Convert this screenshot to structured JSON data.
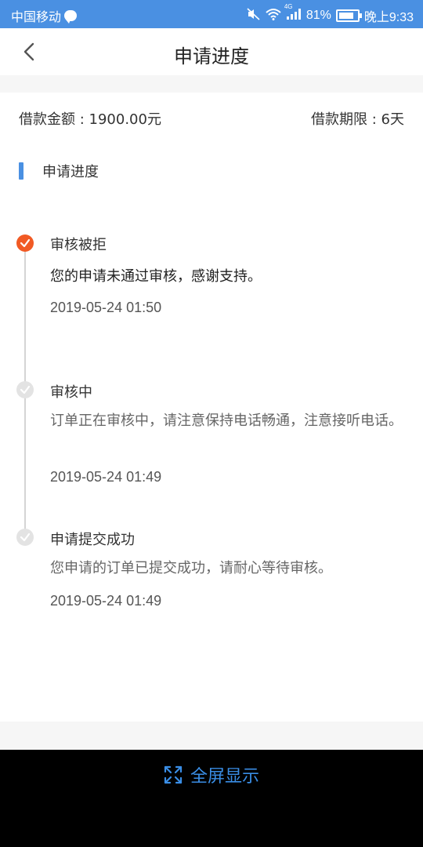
{
  "status_bar": {
    "carrier": "中国移动",
    "network": "4G",
    "battery": "81%",
    "time": "晚上9:33",
    "icons": [
      "chat-bubble-icon",
      "mute-icon",
      "wifi-icon",
      "signal-icon",
      "battery-icon"
    ]
  },
  "header": {
    "title": "申请进度",
    "back_icon": "chevron-left-icon"
  },
  "loan": {
    "amount_text": "借款金额 : 1900.00元",
    "term_text": "借款期限 : 6天"
  },
  "section": {
    "title": "申请进度",
    "accent_color": "#4a90e2"
  },
  "timeline": [
    {
      "title": "审核被拒",
      "description": "您的申请未通过审核，感谢支持。",
      "time": "2019-05-24 01:50",
      "status": "active",
      "icon": "check-circle-icon",
      "color": "#f15a24"
    },
    {
      "title": "审核中",
      "description": "订单正在审核中，请注意保持电话畅通，注意接听电话。",
      "time": "2019-05-24 01:49",
      "status": "done",
      "icon": "check-circle-icon",
      "color": "#e3e3e3"
    },
    {
      "title": "申请提交成功",
      "description": "您申请的订单已提交成功，请耐心等待审核。",
      "time": "2019-05-24 01:49",
      "status": "done",
      "icon": "check-circle-icon",
      "color": "#e3e3e3"
    }
  ],
  "bottom_bar": {
    "fullscreen_label": "全屏显示",
    "fullscreen_icon": "expand-icon",
    "accent_color": "#3a8ee6"
  }
}
